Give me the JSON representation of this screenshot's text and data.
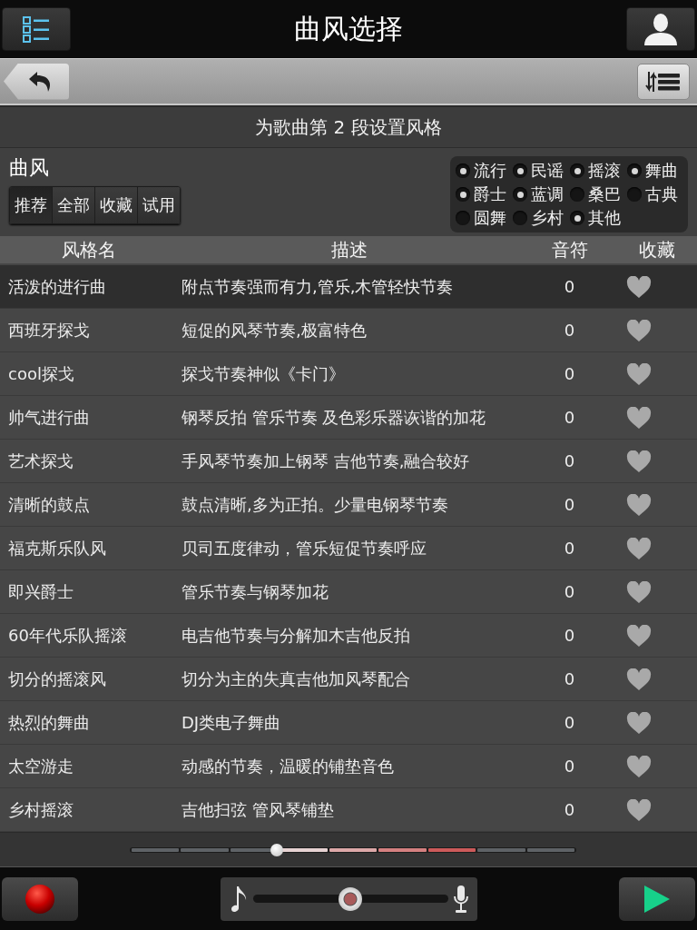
{
  "header": {
    "title": "曲风选择"
  },
  "section_title": "为歌曲第 2 段设置风格",
  "filter": {
    "label": "曲风",
    "tabs": [
      {
        "label": "推荐",
        "selected": true
      },
      {
        "label": "全部",
        "selected": false
      },
      {
        "label": "收藏",
        "selected": false
      },
      {
        "label": "试用",
        "selected": false
      }
    ],
    "categories": [
      {
        "label": "流行",
        "checked": true
      },
      {
        "label": "民谣",
        "checked": true
      },
      {
        "label": "摇滚",
        "checked": true
      },
      {
        "label": "舞曲",
        "checked": true
      },
      {
        "label": "爵士",
        "checked": true
      },
      {
        "label": "蓝调",
        "checked": true
      },
      {
        "label": "桑巴",
        "checked": false
      },
      {
        "label": "古典",
        "checked": false
      },
      {
        "label": "圆舞",
        "checked": false
      },
      {
        "label": "乡村",
        "checked": false
      },
      {
        "label": "其他",
        "checked": true
      }
    ]
  },
  "table": {
    "columns": [
      "风格名",
      "描述",
      "音符",
      "收藏"
    ],
    "rows": [
      {
        "name": "活泼的进行曲",
        "description": "附点节奏强而有力,管乐,木管轻快节奏",
        "notes": "0",
        "favorite": false,
        "selected": true
      },
      {
        "name": "西班牙探戈",
        "description": "短促的风琴节奏,极富特色",
        "notes": "0",
        "favorite": false,
        "selected": false
      },
      {
        "name": "cool探戈",
        "description": "探戈节奏神似《卡门》",
        "notes": "0",
        "favorite": false,
        "selected": false
      },
      {
        "name": "帅气进行曲",
        "description": "钢琴反拍 管乐节奏 及色彩乐器诙谐的加花",
        "notes": "0",
        "favorite": false,
        "selected": false
      },
      {
        "name": "艺术探戈",
        "description": "手风琴节奏加上钢琴 吉他节奏,融合较好",
        "notes": "0",
        "favorite": false,
        "selected": false
      },
      {
        "name": "清晰的鼓点",
        "description": "鼓点清晰,多为正拍。少量电钢琴节奏",
        "notes": "0",
        "favorite": false,
        "selected": false
      },
      {
        "name": "福克斯乐队风",
        "description": "贝司五度律动，管乐短促节奏呼应",
        "notes": "0",
        "favorite": false,
        "selected": false
      },
      {
        "name": "即兴爵士",
        "description": "管乐节奏与钢琴加花",
        "notes": "0",
        "favorite": false,
        "selected": false
      },
      {
        "name": "60年代乐队摇滚",
        "description": "电吉他节奏与分解加木吉他反拍",
        "notes": "0",
        "favorite": false,
        "selected": false
      },
      {
        "name": "切分的摇滚风",
        "description": "切分为主的失真吉他加风琴配合",
        "notes": "0",
        "favorite": false,
        "selected": false
      },
      {
        "name": "热烈的舞曲",
        "description": "DJ类电子舞曲",
        "notes": "0",
        "favorite": false,
        "selected": false
      },
      {
        "name": "太空游走",
        "description": "动感的节奏，温暖的铺垫音色",
        "notes": "0",
        "favorite": false,
        "selected": false
      },
      {
        "name": "乡村摇滚",
        "description": "吉他扫弦 管风琴铺垫",
        "notes": "0",
        "favorite": false,
        "selected": false
      }
    ]
  },
  "section_bar": {
    "level": 0.33,
    "segments": [
      {
        "color": "#5e6266"
      },
      {
        "color": "#5e6266"
      },
      {
        "color": "#5e6266"
      },
      {
        "color": "#e6d2d2"
      },
      {
        "color": "#dca8a8"
      },
      {
        "color": "#d48080"
      },
      {
        "color": "#cc5a5a"
      },
      {
        "color": "#5e6266"
      },
      {
        "color": "#5e6266"
      }
    ]
  },
  "mix_slider": {
    "level": 0.5
  }
}
